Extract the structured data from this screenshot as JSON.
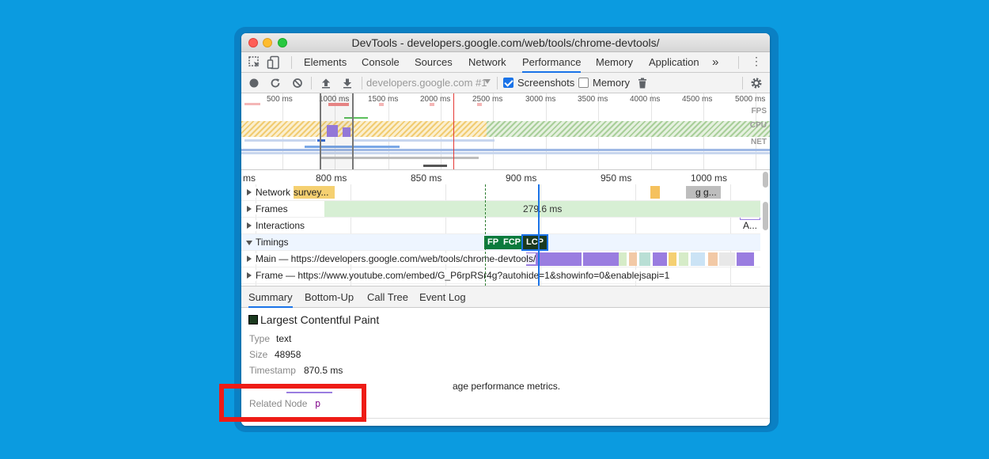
{
  "window": {
    "title": "DevTools - developers.google.com/web/tools/chrome-devtools/"
  },
  "tabs": [
    {
      "label": "Elements"
    },
    {
      "label": "Console"
    },
    {
      "label": "Sources"
    },
    {
      "label": "Network"
    },
    {
      "label": "Performance",
      "active": true
    },
    {
      "label": "Memory"
    },
    {
      "label": "Application"
    }
  ],
  "more_tabs": "»",
  "more_menu": "⋮",
  "toolbar": {
    "recording": "developers.google.com #1",
    "screenshots_label": "Screenshots",
    "screenshots_checked": true,
    "memory_label": "Memory",
    "memory_checked": false
  },
  "overview": {
    "ticks": [
      "500 ms",
      "1000 ms",
      "1500 ms",
      "2000 ms",
      "2500 ms",
      "3000 ms",
      "3500 ms",
      "4000 ms",
      "4500 ms",
      "5000 ms"
    ],
    "lane_labels": {
      "fps": "FPS",
      "cpu": "CPU",
      "net": "NET"
    }
  },
  "flame": {
    "ticks": [
      "ms",
      "800 ms",
      "850 ms",
      "900 ms",
      "950 ms",
      "1000 ms"
    ],
    "tracks": {
      "network": "Network",
      "network_item": "survey...",
      "network_item2": "g g...",
      "frames": "Frames",
      "frames_value": "279.6 ms",
      "interactions": "Interactions",
      "interactions_item": "A...",
      "timings": "Timings",
      "main": "Main — https://developers.google.com/web/tools/chrome-devtools/",
      "frame": "Frame — https://www.youtube.com/embed/G_P6rpRSr4g?autohide=1&showinfo=0&enablejsapi=1"
    },
    "timing_markers": [
      "FP",
      "FCP",
      "LCP"
    ]
  },
  "bottom_tabs": [
    {
      "label": "Summary",
      "active": true
    },
    {
      "label": "Bottom-Up"
    },
    {
      "label": "Call Tree"
    },
    {
      "label": "Event Log"
    }
  ],
  "summary": {
    "title": "Largest Contentful Paint",
    "type_label": "Type",
    "type_value": "text",
    "size_label": "Size",
    "size_value": "48958",
    "timestamp_label": "Timestamp",
    "timestamp_value": "870.5 ms",
    "description_text": "age performance metrics.",
    "related_label": "Related Node",
    "related_value": "p"
  },
  "colors": {
    "background": "#0b9be0",
    "highlight_box": "#ee1c16",
    "accent": "#1a73e8",
    "lcp": "#1b3a1f",
    "fp_fcp": "#0b7a3c"
  }
}
